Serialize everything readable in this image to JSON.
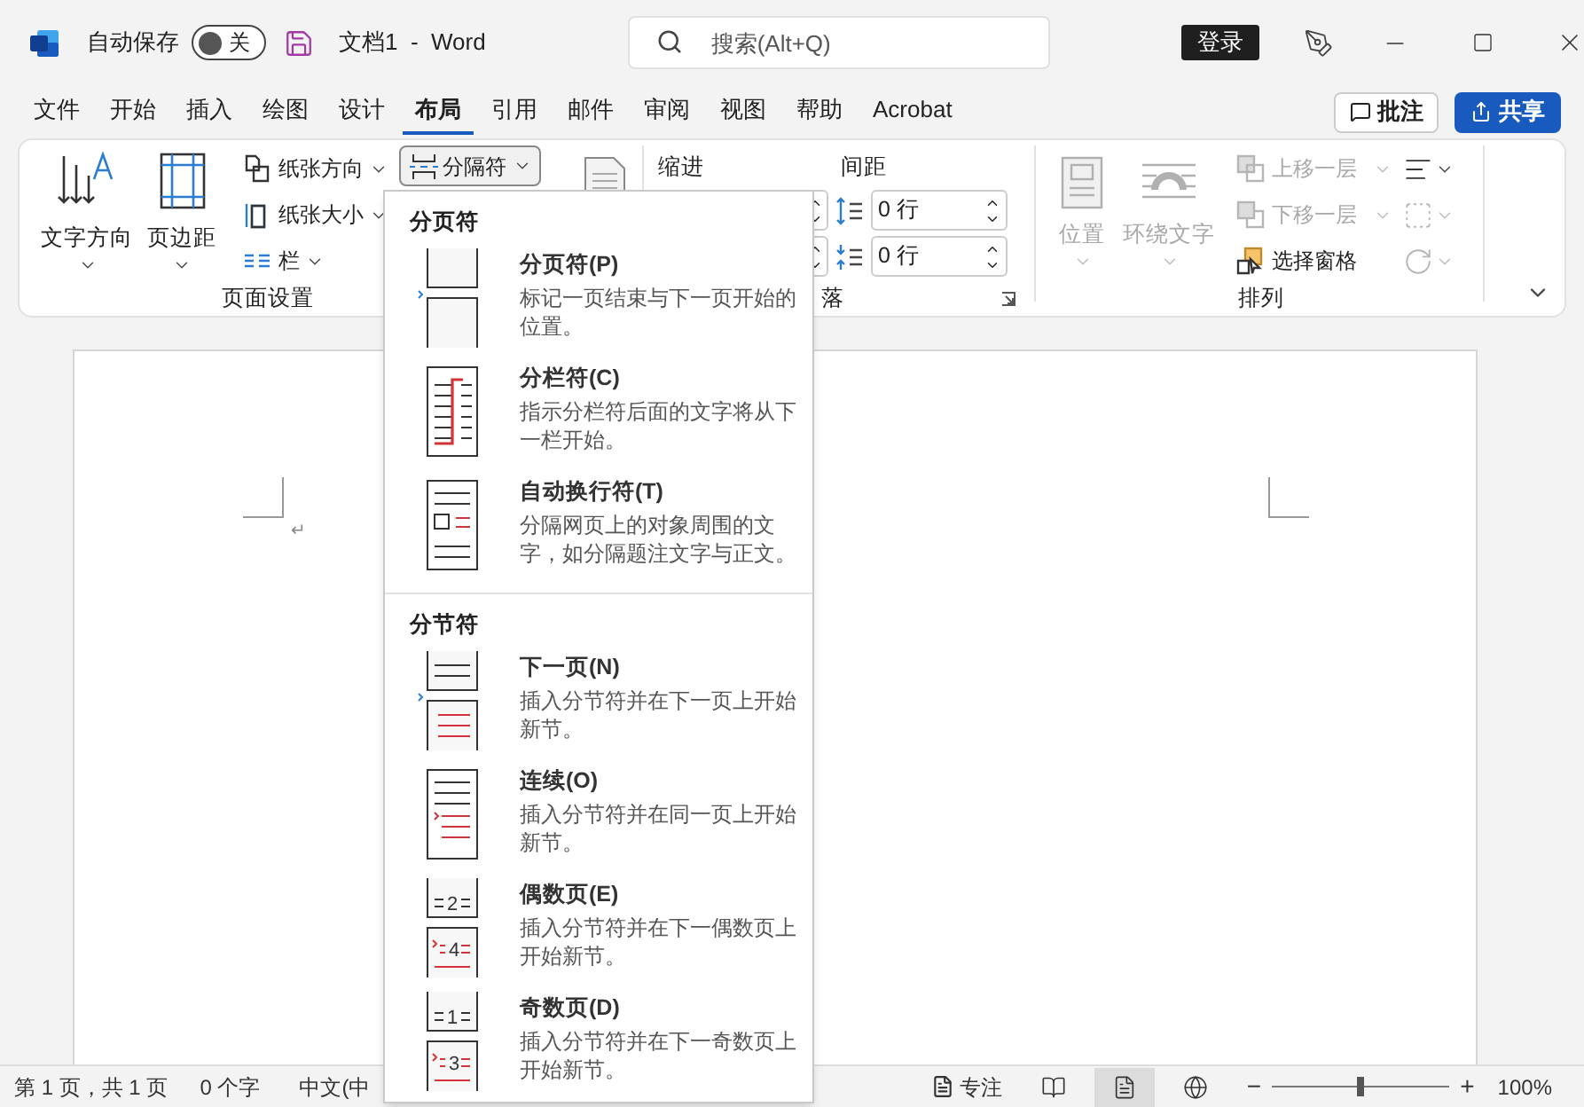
{
  "title_bar": {
    "autosave_label": "自动保存",
    "autosave": {
      "on": false,
      "label": "关"
    },
    "document_title": "文档1  -  Word",
    "search": {
      "placeholder": "搜索(Alt+Q)"
    },
    "sign_in": "登录"
  },
  "menu_tabs": [
    {
      "label": "文件",
      "selected": false
    },
    {
      "label": "开始",
      "selected": false
    },
    {
      "label": "插入",
      "selected": false
    },
    {
      "label": "绘图",
      "selected": false
    },
    {
      "label": "设计",
      "selected": false
    },
    {
      "label": "布局",
      "selected": true
    },
    {
      "label": "引用",
      "selected": false
    },
    {
      "label": "邮件",
      "selected": false
    },
    {
      "label": "审阅",
      "selected": false
    },
    {
      "label": "视图",
      "selected": false
    },
    {
      "label": "帮助",
      "selected": false
    },
    {
      "label": "Acrobat",
      "selected": false
    }
  ],
  "comments_button": "批注",
  "share_button": "共享",
  "ribbon": {
    "page_setup": {
      "large": [
        {
          "kind": "direction",
          "label": "文字方向"
        },
        {
          "kind": "margins",
          "label": "页边距"
        }
      ],
      "small": [
        {
          "kind": "orientation",
          "label": "纸张方向"
        },
        {
          "kind": "size",
          "label": "纸张大小"
        },
        {
          "kind": "columns",
          "label": "栏"
        }
      ],
      "breaks_button": {
        "label": "分隔符",
        "expanded": true
      },
      "group_label": "页面设置"
    },
    "paragraph": {
      "indent_label": "缩进",
      "spacing_label": "间距",
      "spacing_fields": [
        {
          "kind": "before",
          "value": "0 行"
        },
        {
          "kind": "after",
          "value": "0 行"
        }
      ],
      "group_label": "落"
    },
    "arrange": {
      "large": [
        {
          "kind": "position",
          "label": "位置",
          "disabled": true
        },
        {
          "kind": "wrap",
          "label": "环绕文字",
          "disabled": true
        }
      ],
      "small": [
        {
          "kind": "forward",
          "label": "上移一层",
          "disabled": true
        },
        {
          "kind": "backward",
          "label": "下移一层",
          "disabled": true
        },
        {
          "kind": "pane",
          "label": "选择窗格",
          "disabled": false
        }
      ],
      "tools": [
        {
          "kind": "align",
          "disabled": false
        },
        {
          "kind": "group",
          "disabled": true
        },
        {
          "kind": "rotate",
          "disabled": true
        }
      ],
      "group_label": "排列"
    }
  },
  "breaks_menu": {
    "sections": [
      {
        "title": "分页符",
        "items": [
          {
            "kind": "page",
            "title": "分页符(P)",
            "description": "标记一页结束与下一页开始的位置。"
          },
          {
            "kind": "column",
            "title": "分栏符(C)",
            "description": "指示分栏符后面的文字将从下一栏开始。"
          },
          {
            "kind": "wrap",
            "title": "自动换行符(T)",
            "description": "分隔网页上的对象周围的文字，如分隔题注文字与正文。"
          }
        ]
      },
      {
        "title": "分节符",
        "items": [
          {
            "kind": "next",
            "title": "下一页(N)",
            "description": "插入分节符并在下一页上开始新节。"
          },
          {
            "kind": "continuous",
            "title": "连续(O)",
            "description": "插入分节符并在同一页上开始新节。"
          },
          {
            "kind": "even",
            "title": "偶数页(E)",
            "description": "插入分节符并在下一偶数页上开始新节。",
            "page_numbers": [
              "2",
              "4"
            ]
          },
          {
            "kind": "odd",
            "title": "奇数页(D)",
            "description": "插入分节符并在下一奇数页上开始新节。",
            "page_numbers": [
              "1",
              "3"
            ]
          }
        ]
      }
    ]
  },
  "document": {
    "paragraph_mark": "↵"
  },
  "status_bar": {
    "page": "第 1 页，共 1 页",
    "words": "0 个字",
    "language": "中文(中",
    "focus": "专注",
    "views": [
      {
        "kind": "read",
        "selected": false
      },
      {
        "kind": "print",
        "selected": true
      },
      {
        "kind": "web",
        "selected": false
      }
    ],
    "zoom": {
      "minus": "−",
      "plus": "+",
      "level": 0.5,
      "reading": "100%"
    }
  }
}
